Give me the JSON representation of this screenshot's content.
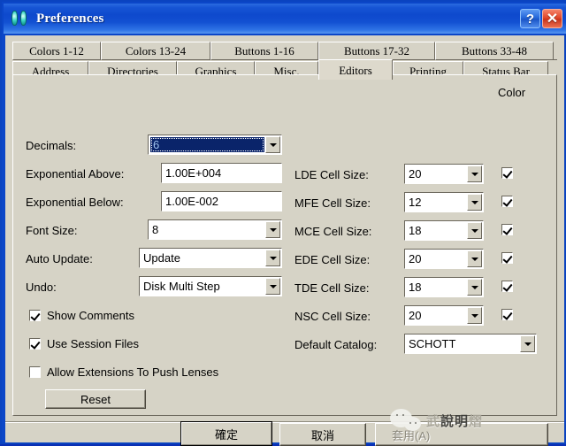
{
  "window": {
    "title": "Preferences",
    "icon": "zemax-icon",
    "help_button": "?",
    "close_button": "✕",
    "title_bar_color": "#0e49cd",
    "face_color": "#d6d3c6"
  },
  "tabs": {
    "row1": [
      {
        "label": "Colors 1-12",
        "selected": false
      },
      {
        "label": "Colors 13-24",
        "selected": false
      },
      {
        "label": "Buttons 1-16",
        "selected": false
      },
      {
        "label": "Buttons 17-32",
        "selected": false
      },
      {
        "label": "Buttons 33-48",
        "selected": false
      }
    ],
    "row2": [
      {
        "label": "Address",
        "selected": false
      },
      {
        "label": "Directories",
        "selected": false
      },
      {
        "label": "Graphics",
        "selected": false
      },
      {
        "label": "Misc.",
        "selected": false
      },
      {
        "label": "Editors",
        "selected": true
      },
      {
        "label": "Printing",
        "selected": false
      },
      {
        "label": "Status Bar",
        "selected": false
      }
    ]
  },
  "panel": {
    "color_header": "Color",
    "left": {
      "decimals": {
        "label": "Decimals:",
        "value": "6",
        "focused": true
      },
      "exponential_above": {
        "label": "Exponential Above:",
        "value": "1.00E+004"
      },
      "exponential_below": {
        "label": "Exponential Below:",
        "value": "1.00E-002"
      },
      "font_size": {
        "label": "Font Size:",
        "value": "8"
      },
      "auto_update": {
        "label": "Auto Update:",
        "value": "Update"
      },
      "undo": {
        "label": "Undo:",
        "value": "Disk Multi Step"
      },
      "show_comments": {
        "label": "Show Comments",
        "checked": true
      },
      "use_session_files": {
        "label": "Use Session Files",
        "checked": true
      },
      "allow_extensions": {
        "label": "Allow Extensions To Push Lenses",
        "checked": false
      },
      "reset_button": "Reset"
    },
    "right": {
      "lde": {
        "label": "LDE Cell Size:",
        "value": "20",
        "color_checked": true
      },
      "mfe": {
        "label": "MFE Cell Size:",
        "value": "12",
        "color_checked": true
      },
      "mce": {
        "label": "MCE Cell Size:",
        "value": "18",
        "color_checked": true
      },
      "ede": {
        "label": "EDE Cell Size:",
        "value": "20",
        "color_checked": true
      },
      "tde": {
        "label": "TDE Cell Size:",
        "value": "18",
        "color_checked": true
      },
      "nsc": {
        "label": "NSC Cell Size:",
        "value": "20",
        "color_checked": true
      },
      "default_catalog": {
        "label": "Default Catalog:",
        "value": "SCHOTT"
      }
    }
  },
  "footer": {
    "ok": "確定",
    "cancel": "取消",
    "apply": "套用(A)",
    "apply_disabled": true
  },
  "watermark": {
    "logo": "wechat-logo",
    "text_dim_left": "武",
    "text_bold": "說明",
    "text_dim_right": "熠"
  }
}
